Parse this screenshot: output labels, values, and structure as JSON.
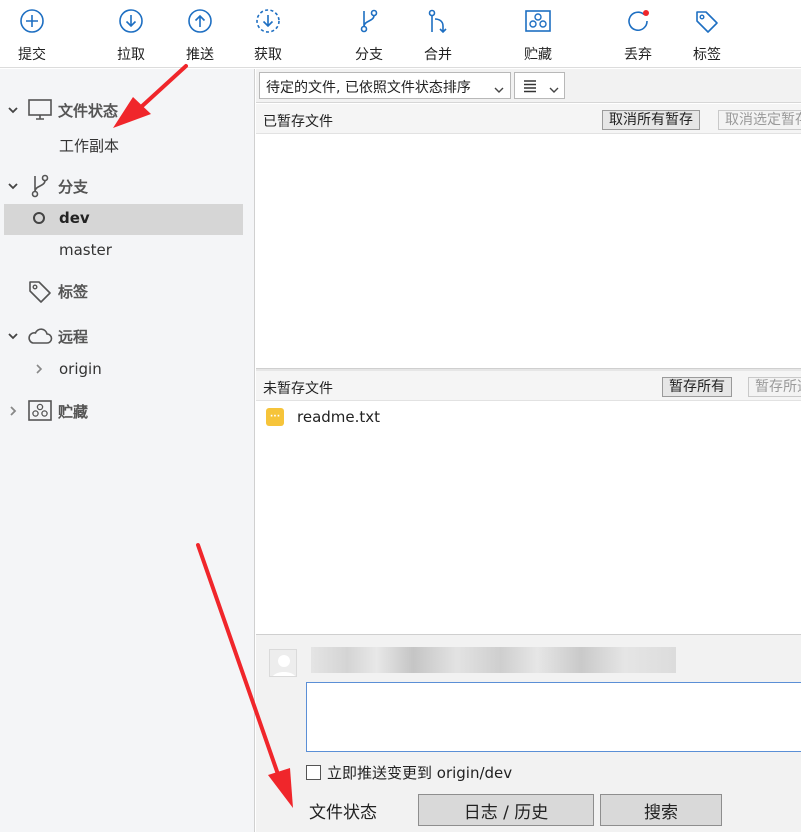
{
  "toolbar": {
    "commit": "提交",
    "pull": "拉取",
    "push": "推送",
    "fetch": "获取",
    "branch": "分支",
    "merge": "合并",
    "stash": "贮藏",
    "discard": "丢弃",
    "tag": "标签"
  },
  "sidebar": {
    "file_status": "文件状态",
    "working_copy": "工作副本",
    "branches": "分支",
    "branch_items": [
      "dev",
      "master"
    ],
    "tags": "标签",
    "remotes": "远程",
    "remote_items": [
      "origin"
    ],
    "stashes": "贮藏"
  },
  "main": {
    "sort_select": "待定的文件, 已依照文件状态排序",
    "staged_title": "已暂存文件",
    "unstage_all": "取消所有暂存",
    "unstage_selected": "取消选定暂存",
    "unstaged_title": "未暂存文件",
    "stage_all": "暂存所有",
    "stage_selected": "暂存所选",
    "files": [
      {
        "name": "readme.txt"
      }
    ],
    "push_immediately": "立即推送变更到 origin/dev"
  },
  "tabs": [
    "文件状态",
    "日志 / 历史",
    "搜索"
  ],
  "colors": {
    "accent": "#1e6fc2",
    "file_modified": "#f6c43a",
    "arrow": "#f0262b"
  }
}
